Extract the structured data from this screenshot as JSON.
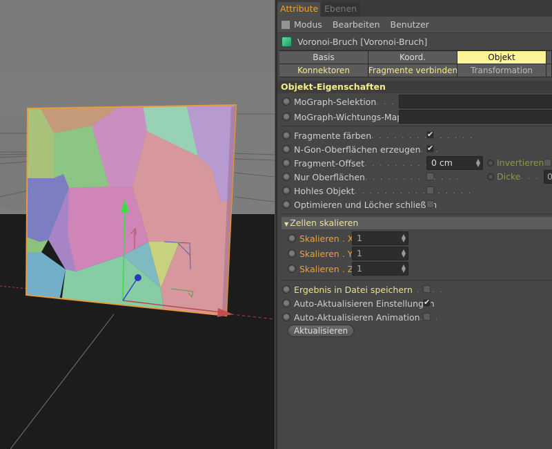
{
  "panel_tabs": [
    {
      "label": "Attribute",
      "active": true
    },
    {
      "label": "Ebenen",
      "active": false
    }
  ],
  "menu": [
    "Modus",
    "Bearbeiten",
    "Benutzer"
  ],
  "object": {
    "icon": "voronoi-cube-icon",
    "name": "Voronoi-Bruch [Voronoi-Bruch]"
  },
  "tabs_row1": [
    {
      "label": "Basis",
      "selected": false
    },
    {
      "label": "Koord.",
      "selected": false
    },
    {
      "label": "Objekt",
      "selected": true
    }
  ],
  "tabs_row2": [
    {
      "label": "Konnektoren"
    },
    {
      "label": "Fragmente verbinden"
    },
    {
      "label": "Transformation"
    }
  ],
  "section_title": "Objekt-Eigenschaften",
  "mograph": {
    "selection_label": "MoGraph-Selektion",
    "selection_dots": ". . . . . .",
    "selection_value": "",
    "weightmap_label": "MoGraph-Wichtungs-Map",
    "weightmap_value": ""
  },
  "options": {
    "fragmente_faerben": {
      "label": "Fragmente färben",
      "dots": ". . . . . . . . . . . . . .",
      "checked": true
    },
    "ngon": {
      "label": "N-Gon-Oberflächen erzeugen",
      "dots": ". . .",
      "checked": true
    },
    "offset": {
      "label": "Fragment-Offset",
      "dots": ". . . . . . . . . . . . . .",
      "value": "0 cm"
    },
    "invertieren": {
      "label": "Invertieren",
      "checked": false
    },
    "nur_oberflaechen": {
      "label": "Nur Oberflächen",
      "dots": ". . . . . . . . . . . . .",
      "checked": false
    },
    "dicke": {
      "label": "Dicke",
      "dots": ". . . . .",
      "value": "0"
    },
    "hohles_objekt": {
      "label": "Hohles Objekt",
      "dots": ". . . . . . . . . . . . . . . .",
      "checked": false
    },
    "optimieren": {
      "label": "Optimieren und Löcher schließen",
      "checked": false
    }
  },
  "zellen": {
    "title": "Zellen skalieren",
    "rows": [
      {
        "label": "Skalieren . X",
        "value": "1"
      },
      {
        "label": "Skalieren . Y",
        "value": "1"
      },
      {
        "label": "Skalieren . Z",
        "value": "1"
      }
    ]
  },
  "bottom": {
    "ergebnis": {
      "label": "Ergebnis in Datei speichern",
      "dots": ". . . .",
      "checked": false
    },
    "auto_einst": {
      "label": "Auto-Aktualisieren Einstellungen",
      "checked": true
    },
    "auto_anim": {
      "label": "Auto-Aktualisieren Animation",
      "dots": ". . .",
      "checked": false
    },
    "update_button": "Aktualisieren"
  },
  "colors": {
    "accent_orange": "#f0a030",
    "tab_selected": "#fbf59a",
    "section_yellow": "#f6ee8a",
    "selection_outline": "#e89a3c"
  }
}
